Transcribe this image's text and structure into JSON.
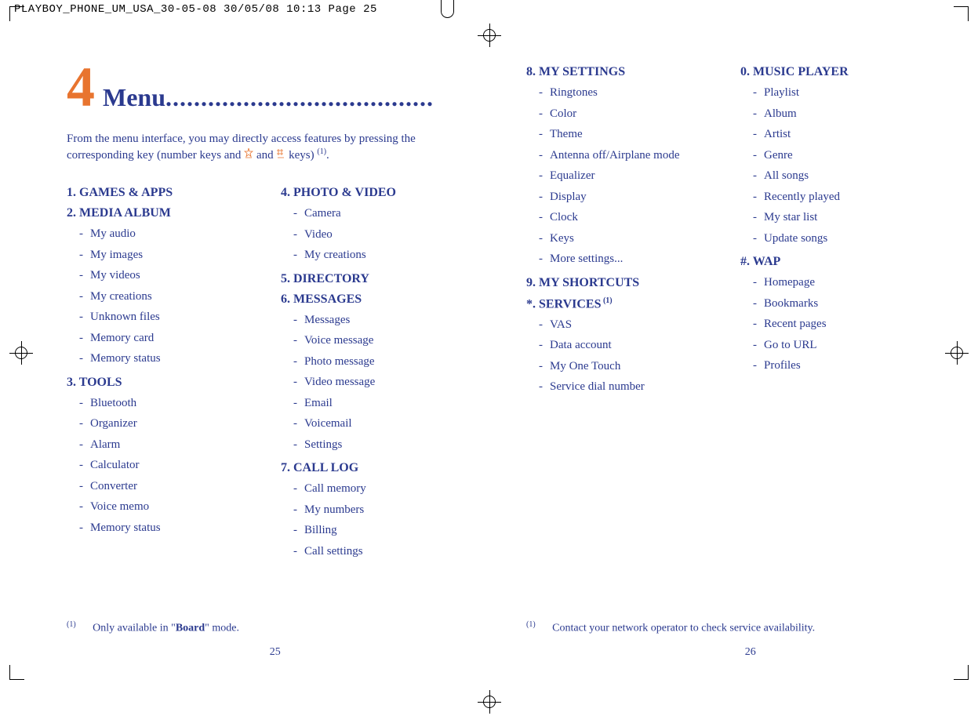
{
  "crop_header": "PLAYBOY_PHONE_UM_USA_30-05-08  30/05/08  10:13  Page 25",
  "chapter": {
    "number": "4",
    "title": "Menu",
    "dots": "......................................"
  },
  "intro": {
    "line1": "From the menu interface, you may directly access features by pressing the",
    "line2_prefix": "corresponding key (number keys and ",
    "line2_mid": " and ",
    "line2_suffix": " keys) ",
    "sup": "(1)",
    "period": "."
  },
  "left_page": {
    "col1": {
      "sections": [
        {
          "title": "1. GAMES & APPS",
          "items": []
        },
        {
          "title": "2. MEDIA ALBUM",
          "items": [
            "My audio",
            "My images",
            "My videos",
            "My creations",
            "Unknown files",
            "Memory card",
            "Memory status"
          ]
        },
        {
          "title": "3. TOOLS",
          "items": [
            "Bluetooth",
            "Organizer",
            "Alarm",
            "Calculator",
            "Converter",
            "Voice memo",
            "Memory status"
          ]
        }
      ]
    },
    "col2": {
      "sections": [
        {
          "title": "4. PHOTO & VIDEO",
          "items": [
            "Camera",
            "Video",
            "My creations"
          ]
        },
        {
          "title": "5. DIRECTORY",
          "items": []
        },
        {
          "title": "6. MESSAGES",
          "items": [
            "Messages",
            "Voice message",
            "Photo message",
            "Video message",
            "Email",
            "Voicemail",
            "Settings"
          ]
        },
        {
          "title": "7. CALL LOG",
          "items": [
            "Call memory",
            "My numbers",
            "Billing",
            "Call settings"
          ]
        }
      ]
    },
    "footnote": {
      "sup": "(1)",
      "prefix": "Only available in \"",
      "bold": "Board",
      "suffix": "\" mode."
    },
    "page_num": "25"
  },
  "right_page": {
    "col1": {
      "sections": [
        {
          "title": "8. MY SETTINGS",
          "items": [
            "Ringtones",
            "Color",
            "Theme",
            "Antenna off/Airplane mode",
            "Equalizer",
            "Display",
            "Clock",
            "Keys",
            "More settings..."
          ]
        },
        {
          "title": "9. MY SHORTCUTS",
          "items": []
        },
        {
          "title": "*. SERVICES",
          "sup": "(1)",
          "items": [
            "VAS",
            "Data account",
            "My One Touch",
            "Service dial number"
          ]
        }
      ]
    },
    "col2": {
      "sections": [
        {
          "title": "0. MUSIC PLAYER",
          "items": [
            "Playlist",
            "Album",
            "Artist",
            "Genre",
            "All songs",
            "Recently played",
            "My star list",
            "Update songs"
          ]
        },
        {
          "title": "#. WAP",
          "items": [
            "Homepage",
            "Bookmarks",
            "Recent pages",
            "Go to URL",
            "Profiles"
          ]
        }
      ]
    },
    "footnote": {
      "sup": "(1)",
      "text": "Contact your network operator to check service availability."
    },
    "page_num": "26"
  }
}
